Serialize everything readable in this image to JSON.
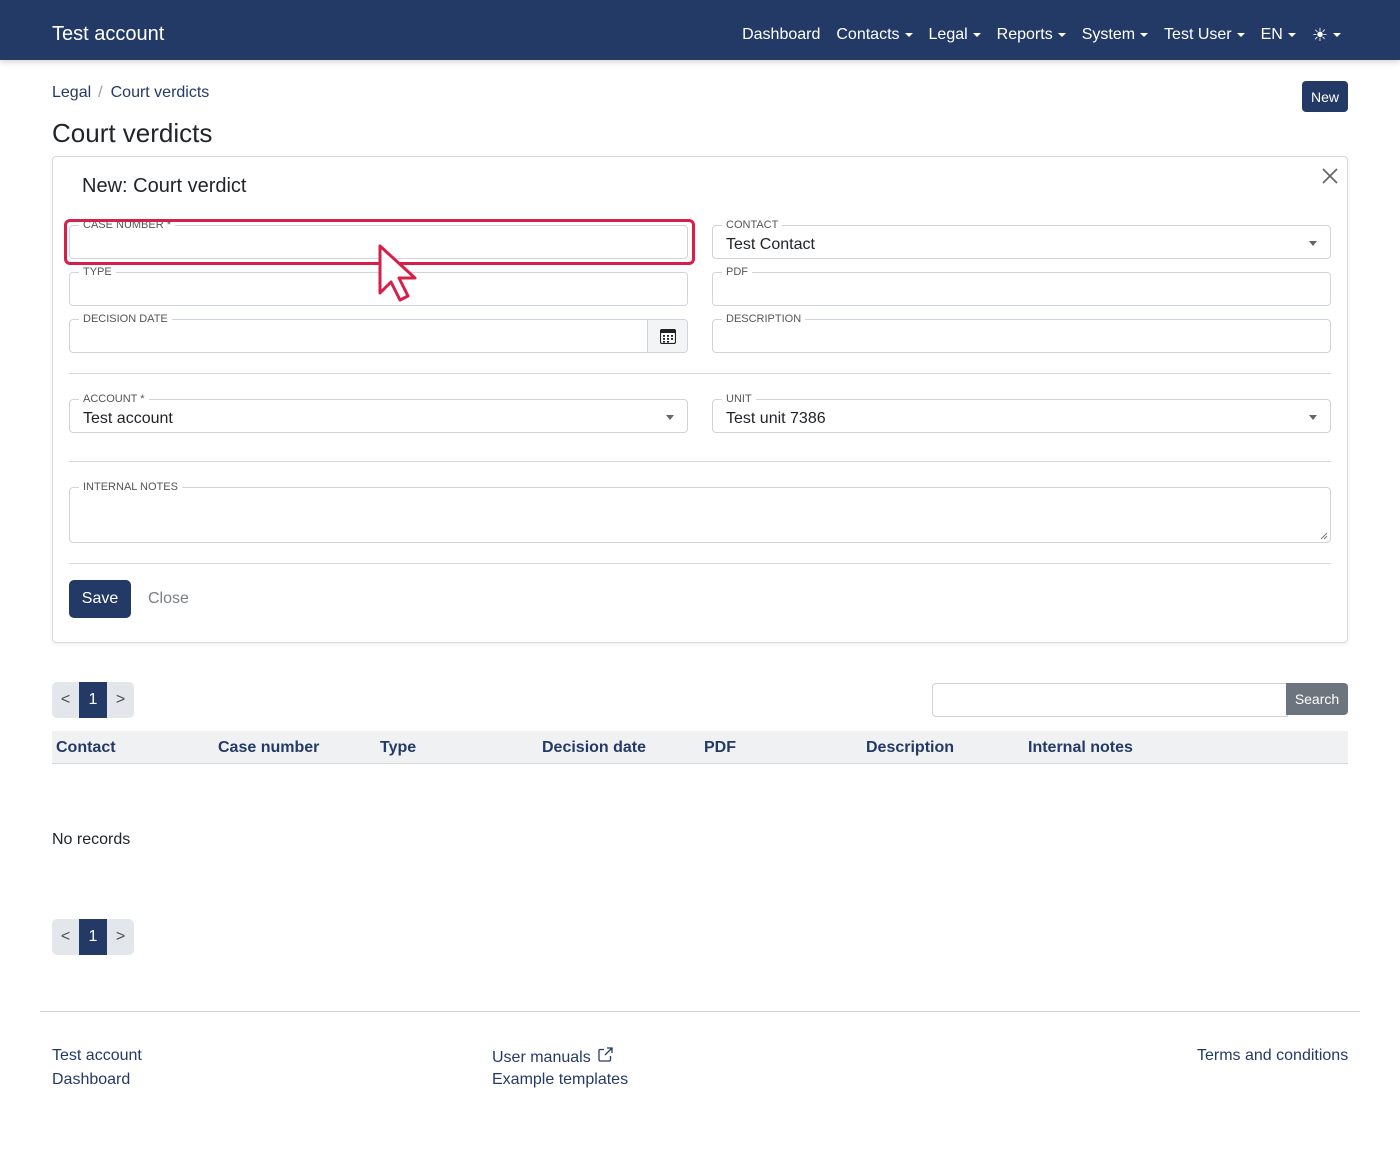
{
  "navbar": {
    "brand": "Test account",
    "items": [
      {
        "label": "Dashboard"
      },
      {
        "label": "Contacts"
      },
      {
        "label": "Legal"
      },
      {
        "label": "Reports"
      },
      {
        "label": "System"
      },
      {
        "label": "Test User"
      },
      {
        "label": "EN"
      },
      {
        "label": "☀"
      }
    ]
  },
  "breadcrumb": [
    "Legal",
    "Court verdicts"
  ],
  "new_button": "New",
  "page_title": "Court verdicts",
  "form": {
    "title": "New: Court verdict",
    "fields": {
      "case_number": {
        "label": "Case number *",
        "value": ""
      },
      "contact": {
        "label": "Contact",
        "value": "Test Contact"
      },
      "type": {
        "label": "Type",
        "value": ""
      },
      "pdf": {
        "label": "PDF",
        "value": ""
      },
      "decision_date": {
        "label": "Decision date",
        "value": ""
      },
      "description": {
        "label": "Description",
        "value": ""
      },
      "account": {
        "label": "Account *",
        "value": "Test account"
      },
      "unit": {
        "label": "Unit",
        "value": "Test unit 7386"
      },
      "internal_notes": {
        "label": "Internal notes",
        "value": ""
      }
    },
    "save_label": "Save",
    "close_label": "Close"
  },
  "pagination": {
    "prev": "<",
    "current": "1",
    "next": ">"
  },
  "search": {
    "button": "Search",
    "value": ""
  },
  "table": {
    "columns": [
      "Contact",
      "Case number",
      "Type",
      "Decision date",
      "PDF",
      "Description",
      "Internal notes"
    ],
    "empty_text": "No records"
  },
  "footer": {
    "col1": [
      "Test account",
      "Dashboard"
    ],
    "col2": [
      "User manuals",
      "Example templates"
    ],
    "col3": [
      "Terms and conditions"
    ]
  },
  "colors": {
    "primary": "#243a66",
    "highlight": "#d6204a",
    "secondary": "#6c757d"
  }
}
